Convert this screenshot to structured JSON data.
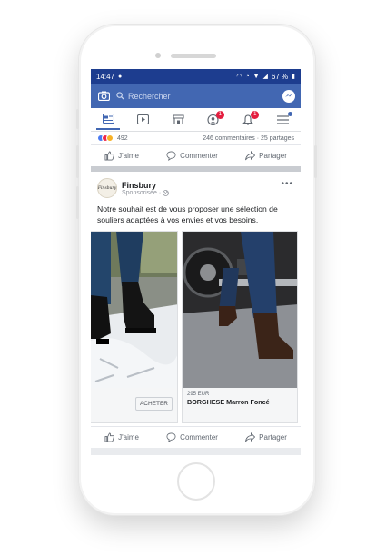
{
  "status": {
    "time": "14:47",
    "battery": "67 %"
  },
  "search": {
    "placeholder": "Rechercher"
  },
  "nav": {
    "friends_badge": "1",
    "notifications_badge": "1"
  },
  "prev_post": {
    "reaction_count": "492",
    "comments_shares": "246 commentaires · 25 partages"
  },
  "actions": {
    "like": "J'aime",
    "comment": "Commenter",
    "share": "Partager"
  },
  "post": {
    "page_name": "Finsbury",
    "sponsored": "Sponsorisée ·",
    "avatar_text": "Finsbury",
    "text": "Notre souhait est de vous proposer une sélection de souliers adaptées à vos envies et vos besoins.",
    "more": "•••"
  },
  "carousel": [
    {
      "price": "",
      "name": "",
      "cta": "ACHETER"
    },
    {
      "price": "295 EUR",
      "name": "BORGHESE Marron Foncé",
      "cta": ""
    }
  ],
  "colors": {
    "brand": "#4267b2",
    "status_bar": "#1d3d8f",
    "badge": "#e41e3f"
  }
}
